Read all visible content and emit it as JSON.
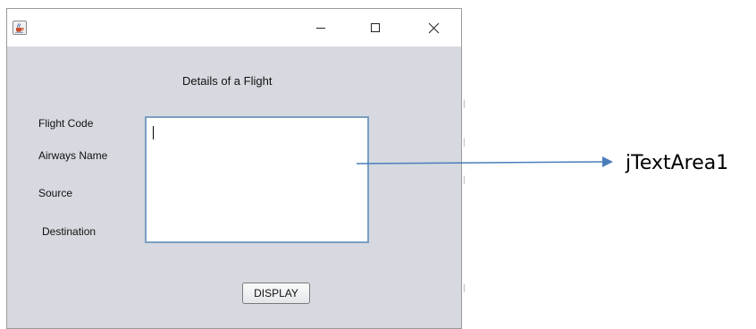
{
  "window": {
    "title_icon": "java-coffee-cup-icon",
    "controls": {
      "minimize_icon": "minimize-icon",
      "maximize_icon": "maximize-icon",
      "close_icon": "close-icon"
    }
  },
  "form": {
    "title": "Details of a Flight",
    "labels": {
      "flight_code": "Flight Code",
      "airways_name": "Airways Name",
      "source": "Source",
      "destination": "Destination"
    },
    "text_area_value": "",
    "display_button": "DISPLAY"
  },
  "annotation": {
    "label": "jTextArea1",
    "color": "#4a7ebb"
  }
}
